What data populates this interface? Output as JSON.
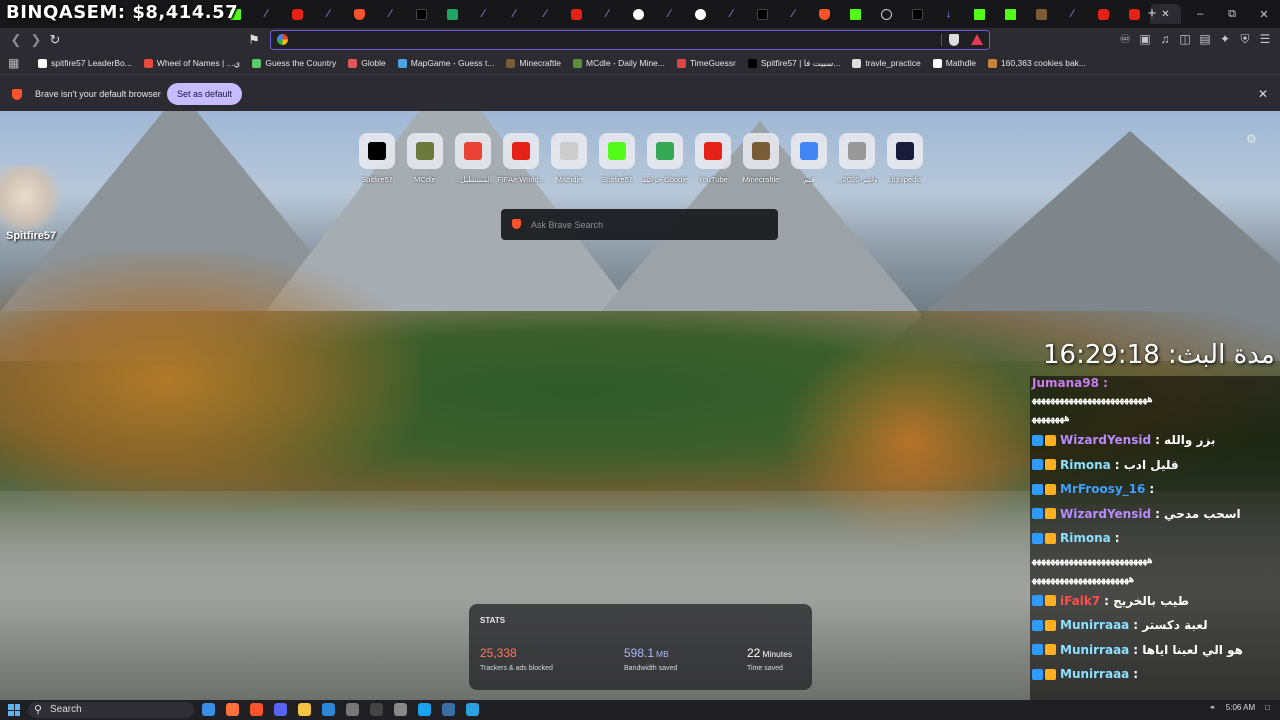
{
  "overlay": {
    "stream_title": "BINQASEM: $8,414.57"
  },
  "tabs": [
    {
      "icon": "kick-icon"
    },
    {
      "icon": "pen-icon"
    },
    {
      "icon": "youtube-icon"
    },
    {
      "icon": "pen-icon"
    },
    {
      "icon": "brave-icon"
    },
    {
      "icon": "pen-icon"
    },
    {
      "icon": "x-icon"
    },
    {
      "icon": "sheets-icon"
    },
    {
      "icon": "pen-icon"
    },
    {
      "icon": "pen-icon"
    },
    {
      "icon": "pen-icon"
    },
    {
      "icon": "youtube-icon"
    },
    {
      "icon": "pen-icon"
    },
    {
      "icon": "google-icon"
    },
    {
      "icon": "pen-icon"
    },
    {
      "icon": "google-icon"
    },
    {
      "icon": "pen-icon"
    },
    {
      "icon": "x-icon"
    },
    {
      "icon": "pen-icon"
    },
    {
      "icon": "brave-icon"
    },
    {
      "icon": "kick-icon"
    },
    {
      "icon": "globe-icon"
    },
    {
      "icon": "x-icon"
    },
    {
      "icon": "download-icon"
    },
    {
      "icon": "kick-icon"
    },
    {
      "icon": "kick-icon"
    },
    {
      "icon": "minecraft-icon"
    },
    {
      "icon": "pen-icon"
    },
    {
      "icon": "youtube-icon"
    },
    {
      "icon": "youtube-icon"
    },
    {
      "icon": "active-tab-close-icon"
    }
  ],
  "address_bar": {
    "value": ""
  },
  "bookmarks": [
    {
      "label": "spitfire57 LeaderBo...",
      "color": "#ffffff"
    },
    {
      "label": "Wheel of Names | ...ي",
      "color": "#e94b3c"
    },
    {
      "label": "Guess the Country",
      "color": "#5cc96b"
    },
    {
      "label": "Globle",
      "color": "#e05555"
    },
    {
      "label": "MapGame - Guess t...",
      "color": "#4aa3df"
    },
    {
      "label": "Minecraftle",
      "color": "#7a5c36"
    },
    {
      "label": "MCdle - Daily Mine...",
      "color": "#5b8f3a"
    },
    {
      "label": "TimeGuessr",
      "color": "#e04646"
    },
    {
      "label": "Spitfire57 | سبيت فا...",
      "color": "#000000"
    },
    {
      "label": "travle_practice",
      "color": "#dddddd"
    },
    {
      "label": "Mathdle",
      "color": "#ffffff"
    },
    {
      "label": "160,363 cookies bak...",
      "color": "#c6853b"
    }
  ],
  "infobar": {
    "message": "Brave isn't your default browser",
    "button": "Set as default"
  },
  "streamer": {
    "name": "Spitfire57"
  },
  "shortcuts": [
    {
      "label": "Spitfire57",
      "color": "#000000"
    },
    {
      "label": "MCdle",
      "color": "#6b7a3a"
    },
    {
      "label": "...المستطيل",
      "color": "#ea4335"
    },
    {
      "label": "FIFAe World...",
      "color": "#e62117"
    },
    {
      "label": "Mathdle",
      "color": "#cccccc"
    },
    {
      "label": "Spitfire57",
      "color": "#53fc18"
    },
    {
      "label": "خرائط Google",
      "color": "#34a853"
    },
    {
      "label": "YouTube",
      "color": "#e62117"
    },
    {
      "label": "Minecraftle",
      "color": "#7a5c36"
    },
    {
      "label": "قيم",
      "color": "#4285f4"
    },
    {
      "label": "...واشر 2026",
      "color": "#999999"
    },
    {
      "label": "Liquipedia",
      "color": "#1a1a3a"
    }
  ],
  "search": {
    "placeholder": "Ask Brave Search"
  },
  "stats": {
    "heading": "STATS",
    "trackers": {
      "value": "25,338",
      "desc": "Trackers & ads blocked",
      "color": "#ff7a5c"
    },
    "bandwidth": {
      "value": "598.1",
      "unit": "MB",
      "desc": "Bandwidth saved",
      "color": "#a9b8ff"
    },
    "time": {
      "value": "22",
      "unit": "Minutes",
      "desc": "Time saved",
      "color": "#ffffff"
    }
  },
  "stream_clock": "مدة البث: 16:29:18",
  "chat": [
    {
      "type": "partial",
      "user": "Jumana98 :",
      "color": "#c87cf0"
    },
    {
      "type": "text",
      "text": "ﻫﻬﻬﻬﻬﻬﻬﻬﻬﻬﻬﻬﻬﻬﻬﻬﻬﻬﻬﻬﻬﻬﻬﻬﻬﻬ"
    },
    {
      "type": "text",
      "text": "ﻫﻬﻬﻬﻬﻬﻬﻬ"
    },
    {
      "type": "msg",
      "user": "WizardYensid",
      "color": "#b98bff",
      "text": ": بزر والله"
    },
    {
      "type": "msg",
      "user": "Rimona",
      "color": "#8de0ff",
      "text": ": قليل ادب"
    },
    {
      "type": "msg",
      "user": "MrFroosy_16",
      "color": "#3fa0ff",
      "text": ":"
    },
    {
      "type": "msg",
      "user": "WizardYensid",
      "color": "#b98bff",
      "text": ": اسحب مدحي"
    },
    {
      "type": "msg",
      "user": "Rimona",
      "color": "#8de0ff",
      "text": ":"
    },
    {
      "type": "text",
      "text": "ﻫﻬﻬﻬﻬﻬﻬﻬﻬﻬﻬﻬﻬﻬﻬﻬﻬﻬﻬﻬﻬﻬﻬﻬﻬﻬ"
    },
    {
      "type": "text",
      "text": "ﻫﻬﻬﻬﻬﻬﻬﻬﻬﻬﻬﻬﻬﻬﻬﻬﻬﻬﻬﻬﻬﻬ"
    },
    {
      "type": "msg",
      "user": "iFalk7",
      "color": "#ff4d4d",
      "text": ": طيب بالخريج"
    },
    {
      "type": "msg",
      "user": "Munirraaa",
      "color": "#8de0ff",
      "text": ": لعبة دكستر"
    },
    {
      "type": "msg",
      "user": "Munirraaa",
      "color": "#8de0ff",
      "text": ": هو الي لعبنا اياها"
    },
    {
      "type": "msg",
      "user": "Munirraaa",
      "color": "#8de0ff",
      "text": ":"
    }
  ],
  "taskbar": {
    "search_label": "Search",
    "clock": "5:06 AM"
  }
}
